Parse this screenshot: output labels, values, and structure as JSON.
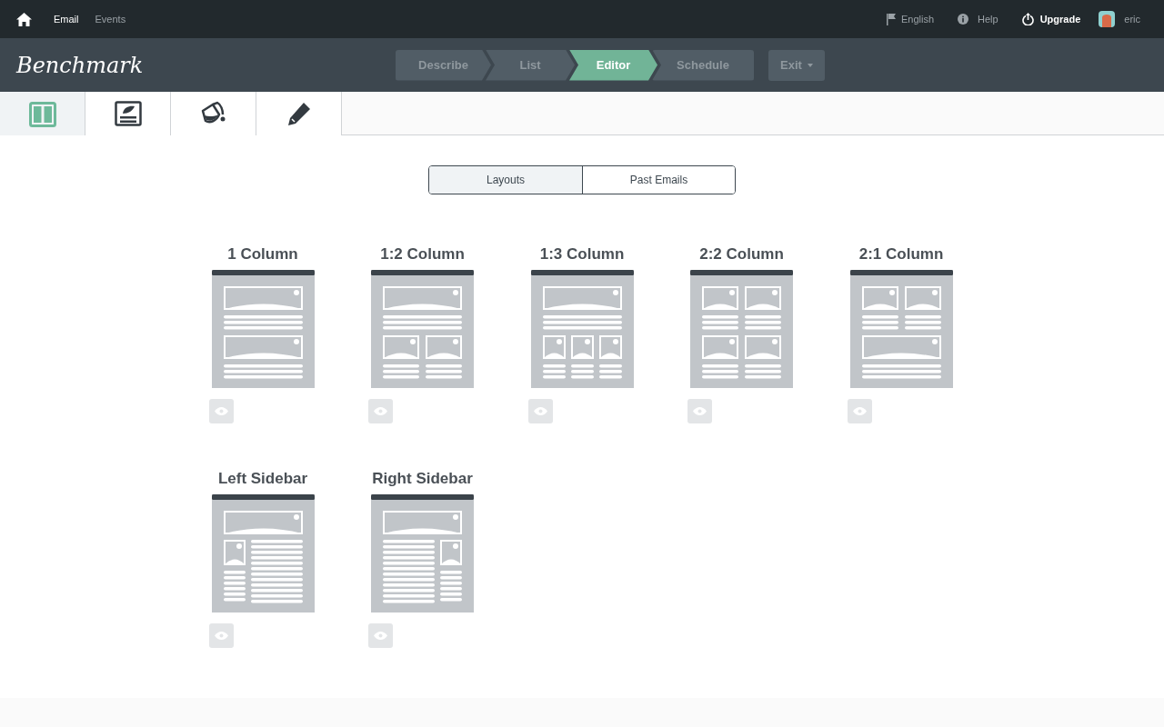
{
  "top_nav": {
    "items": [
      {
        "label": "Email",
        "selected": true
      },
      {
        "label": "Events",
        "selected": false
      }
    ],
    "language": "English",
    "help": "Help",
    "upgrade": "Upgrade",
    "user": "eric"
  },
  "header": {
    "logo": "Benchmark",
    "steps": [
      {
        "label": "Describe",
        "selected": false
      },
      {
        "label": "List",
        "selected": false
      },
      {
        "label": "Editor",
        "selected": true
      },
      {
        "label": "Schedule",
        "selected": false
      }
    ],
    "exit": "Exit"
  },
  "toolbar": [
    {
      "kind": "layout",
      "selected": true
    },
    {
      "kind": "content",
      "selected": false
    },
    {
      "kind": "style",
      "selected": false
    },
    {
      "kind": "edit",
      "selected": false
    }
  ],
  "toggle": [
    {
      "label": "Layouts",
      "selected": true
    },
    {
      "label": "Past Emails",
      "selected": false
    }
  ],
  "layouts": [
    {
      "title": "1 Column",
      "kind": "one"
    },
    {
      "title": "1:2 Column",
      "kind": "one-two"
    },
    {
      "title": "1:3 Column",
      "kind": "one-three"
    },
    {
      "title": "2:2 Column",
      "kind": "two-two"
    },
    {
      "title": "2:1 Column",
      "kind": "two-one"
    },
    {
      "title": "Left Sidebar",
      "kind": "left-sidebar"
    },
    {
      "title": "Right Sidebar",
      "kind": "right-sidebar"
    }
  ]
}
